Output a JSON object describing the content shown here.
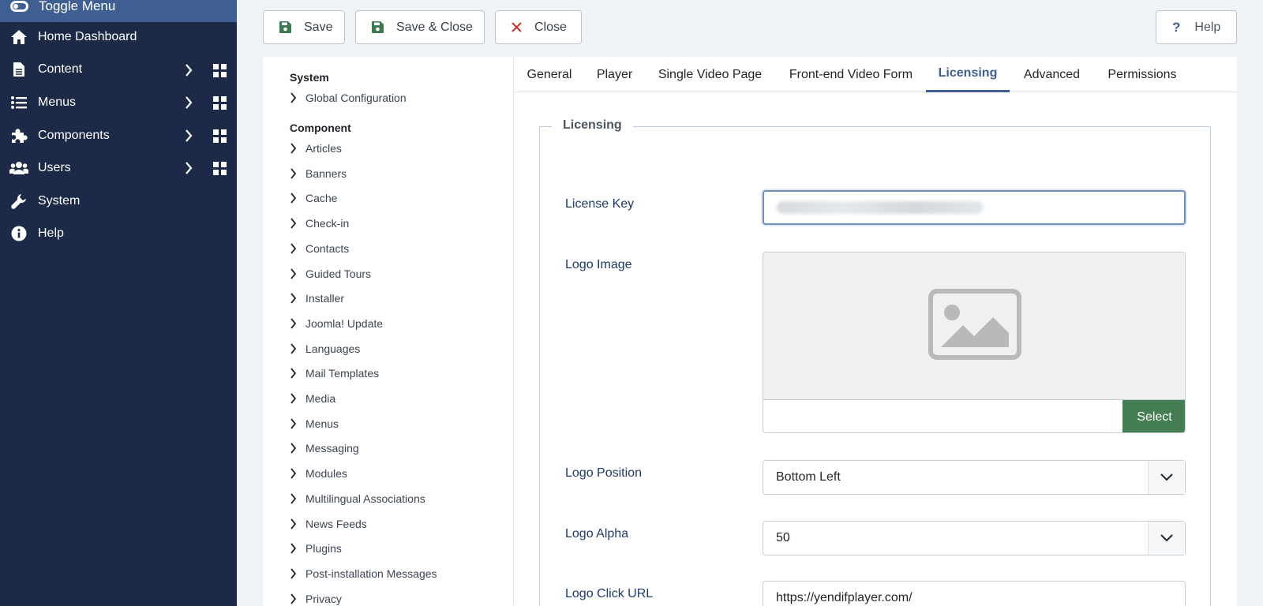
{
  "sidebar": {
    "toggle_label": "Toggle Menu",
    "items": [
      {
        "label": "Home Dashboard",
        "icon": "home-icon"
      },
      {
        "label": "Content",
        "icon": "file-icon"
      },
      {
        "label": "Menus",
        "icon": "list-icon"
      },
      {
        "label": "Components",
        "icon": "puzzle-icon"
      },
      {
        "label": "Users",
        "icon": "users-icon"
      },
      {
        "label": "System",
        "icon": "wrench-icon"
      },
      {
        "label": "Help",
        "icon": "info-icon"
      }
    ]
  },
  "toolbar": {
    "save_label": "Save",
    "save_close_label": "Save & Close",
    "close_label": "Close",
    "help_label": "Help"
  },
  "leftnav": {
    "system_heading": "System",
    "global_config": "Global Configuration",
    "component_heading": "Component",
    "items": [
      "Articles",
      "Banners",
      "Cache",
      "Check-in",
      "Contacts",
      "Guided Tours",
      "Installer",
      "Joomla! Update",
      "Languages",
      "Mail Templates",
      "Media",
      "Menus",
      "Messaging",
      "Modules",
      "Multilingual Associations",
      "News Feeds",
      "Plugins",
      "Post-installation Messages",
      "Privacy"
    ]
  },
  "tabs": [
    "General",
    "Player",
    "Single Video Page",
    "Front-end Video Form",
    "Licensing",
    "Advanced",
    "Permissions"
  ],
  "active_tab": "Licensing",
  "form": {
    "legend": "Licensing",
    "license_key_label": "License Key",
    "logo_image_label": "Logo Image",
    "select_label": "Select",
    "logo_position_label": "Logo Position",
    "logo_position_value": "Bottom Left",
    "logo_alpha_label": "Logo Alpha",
    "logo_alpha_value": "50",
    "logo_click_url_label": "Logo Click URL",
    "logo_click_url_value": "https://yendifplayer.com/"
  },
  "colors": {
    "sidebar_bg": "#1c2a47",
    "toggle_bg": "#3f5f93",
    "accent": "#3f5f93",
    "select_button": "#457d54",
    "save_icon": "#3d7a4f",
    "close_icon": "#c9302c"
  }
}
